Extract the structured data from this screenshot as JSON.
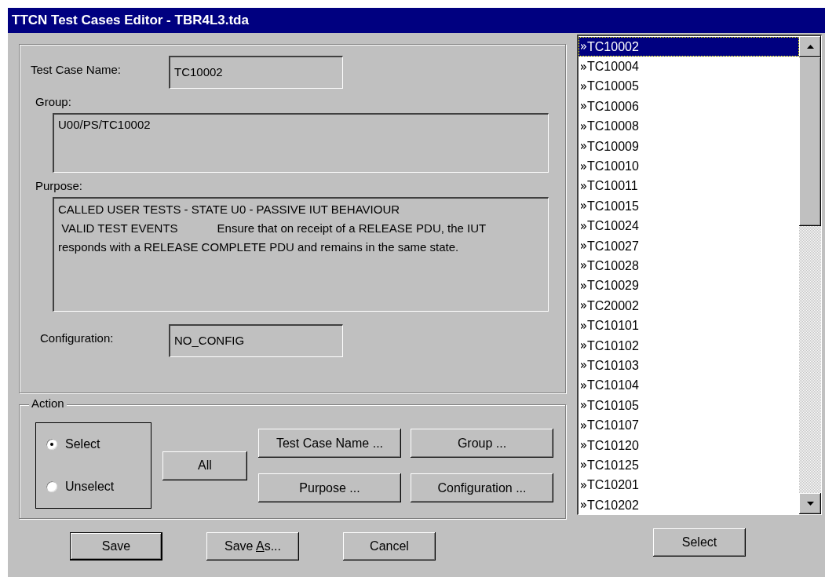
{
  "window": {
    "title": "TTCN Test Cases Editor - TBR4L3.tda"
  },
  "details": {
    "name_label": "Test Case Name:",
    "name_value": "TC10002",
    "group_label": "Group:",
    "group_value": "U00/PS/TC10002",
    "purpose_label": "Purpose:",
    "purpose_value": "CALLED USER TESTS - STATE U0 - PASSIVE IUT BEHAVIOUR\n VALID TEST EVENTS            Ensure that on receipt of a RELEASE PDU, the IUT responds with a RELEASE COMPLETE PDU and remains in the same state.",
    "config_label": "Configuration:",
    "config_value": "NO_CONFIG"
  },
  "action": {
    "title": "Action",
    "modes": [
      {
        "label": "Select",
        "selected": true
      },
      {
        "label": "Unselect",
        "selected": false
      }
    ],
    "all_button": "All",
    "filter_buttons": [
      "Test Case Name ...",
      "Group ...",
      "Purpose ...",
      "Configuration ..."
    ]
  },
  "buttons": [
    {
      "label": "Save",
      "default": true
    },
    {
      "label_before": "Save ",
      "mnemonic": "A",
      "label_after": "s...",
      "default": false
    },
    {
      "label": "Cancel",
      "default": false
    }
  ],
  "test_cases": [
    {
      "label": "TC10002",
      "selected": true
    },
    {
      "label": "TC10004",
      "selected": false
    },
    {
      "label": "TC10005",
      "selected": false
    },
    {
      "label": "TC10006",
      "selected": false
    },
    {
      "label": "TC10008",
      "selected": false
    },
    {
      "label": "TC10009",
      "selected": false
    },
    {
      "label": "TC10010",
      "selected": false
    },
    {
      "label": "TC10011",
      "selected": false
    },
    {
      "label": "TC10015",
      "selected": false
    },
    {
      "label": "TC10024",
      "selected": false
    },
    {
      "label": "TC10027",
      "selected": false
    },
    {
      "label": "TC10028",
      "selected": false
    },
    {
      "label": "TC10029",
      "selected": false
    },
    {
      "label": "TC20002",
      "selected": false
    },
    {
      "label": "TC10101",
      "selected": false
    },
    {
      "label": "TC10102",
      "selected": false
    },
    {
      "label": "TC10103",
      "selected": false
    },
    {
      "label": "TC10104",
      "selected": false
    },
    {
      "label": "TC10105",
      "selected": false
    },
    {
      "label": "TC10107",
      "selected": false
    },
    {
      "label": "TC10120",
      "selected": false
    },
    {
      "label": "TC10125",
      "selected": false
    },
    {
      "label": "TC10201",
      "selected": false
    },
    {
      "label": "TC10202",
      "selected": false
    }
  ],
  "list_button": "Select"
}
